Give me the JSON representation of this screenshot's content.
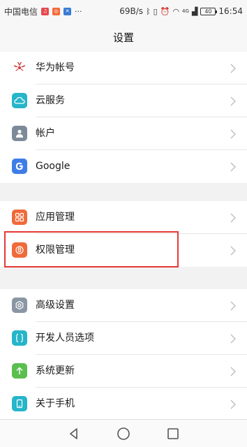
{
  "status_bar": {
    "carrier": "中国电信",
    "speed": "69B/s",
    "network": "4G",
    "battery": "40",
    "time": "16:54"
  },
  "header": {
    "title": "设置"
  },
  "groups": [
    {
      "items": [
        {
          "label": "华为帐号",
          "icon": "huawei-logo-icon",
          "color": "#d33b3b"
        },
        {
          "label": "云服务",
          "icon": "cloud-icon",
          "color": "#26b5c9"
        },
        {
          "label": "帐户",
          "icon": "person-icon",
          "color": "#7d8a99"
        },
        {
          "label": "Google",
          "icon": "google-icon",
          "color": "#3f7de6"
        }
      ]
    },
    {
      "items": [
        {
          "label": "应用管理",
          "icon": "apps-grid-icon",
          "color": "#f06a3a"
        },
        {
          "label": "权限管理",
          "icon": "permission-icon",
          "color": "#f06a3a"
        }
      ]
    },
    {
      "items": [
        {
          "label": "高级设置",
          "icon": "gear-icon",
          "color": "#8a96a3"
        },
        {
          "label": "开发人员选项",
          "icon": "braces-icon",
          "color": "#26b5c9"
        },
        {
          "label": "系统更新",
          "icon": "update-arrow-icon",
          "color": "#5bbf4f"
        },
        {
          "label": "关于手机",
          "icon": "phone-icon",
          "color": "#26b5c9"
        }
      ]
    }
  ],
  "colors": {
    "highlight": "#e53935"
  }
}
